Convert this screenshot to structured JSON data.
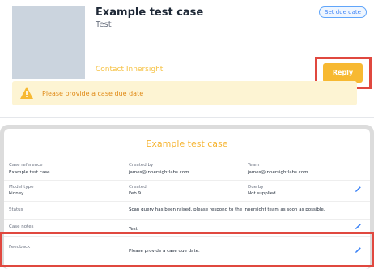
{
  "header": {
    "title": "Example test case",
    "subtitle": "Test",
    "due_chip": "Set due date",
    "contact_link": "Contact Innersight",
    "reply_label": "Reply"
  },
  "alert": {
    "text": "Please provide a case due date"
  },
  "details": {
    "title": "Example test case",
    "case_reference": {
      "label": "Case reference",
      "value": "Example test case"
    },
    "created_by": {
      "label": "Created by",
      "value": "james@innersightlabs.com"
    },
    "team": {
      "label": "Team",
      "value": "james@innersightlabs.com"
    },
    "model_type": {
      "label": "Model type",
      "value": "kidney"
    },
    "created": {
      "label": "Created",
      "value": "Feb 9"
    },
    "due_by": {
      "label": "Due by",
      "value": "Not supplied"
    },
    "status": {
      "label": "Status",
      "value": "Scan query has been raised, please respond to the Innersight team as soon as possible."
    },
    "case_notes": {
      "label": "Case notes",
      "value": "Test"
    },
    "feedback": {
      "label": "Feedback",
      "value": "Please provide a case due date."
    }
  },
  "colors": {
    "accent": "#f7b932",
    "highlight": "#e0483f",
    "alert_bg": "#fdf4d3",
    "chip": "#3b82f6"
  },
  "icons": {
    "alert": "warning-triangle-icon",
    "edit": "pencil-icon"
  }
}
